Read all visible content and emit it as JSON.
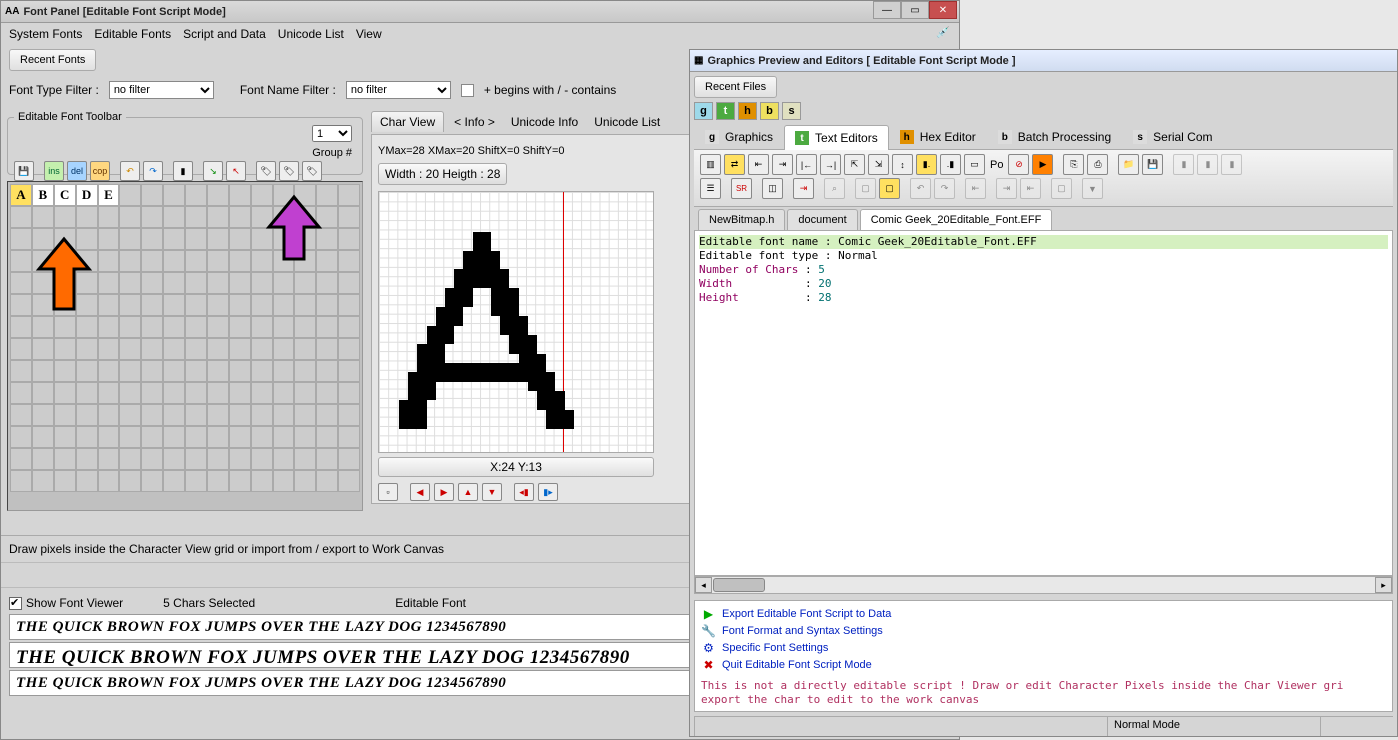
{
  "leftWindow": {
    "title": "Font Panel [Editable Font Script Mode]",
    "icon": "AA",
    "menu": [
      "System Fonts",
      "Editable Fonts",
      "Script and Data",
      "Unicode List",
      "View"
    ],
    "recentLabel": "Recent Fonts",
    "fontTypeFilterLabel": "Font Type Filter :",
    "fontTypeFilterValue": "no filter",
    "fontNameFilterLabel": "Font Name Filter :",
    "fontNameFilterValue": "no filter",
    "filterNote": "+ begins with / - contains",
    "toolbarLegend": "Editable Font Toolbar",
    "groupValue": "1",
    "groupLabel": "Group #",
    "btnIns": "ins",
    "btnDel": "del",
    "btnCop": "cop",
    "chars": [
      "A",
      "B",
      "C",
      "D",
      "E"
    ],
    "charViewTab": "Char View",
    "infoTab": "< Info >",
    "unicodeTab": "Unicode Info",
    "unicodeListTab": "Unicode List",
    "yxStats": "YMax=28  XMax=20  ShiftX=0  ShiftY=0",
    "whLabel": "Width : 20  Heigth : 28",
    "coord": "X:24 Y:13",
    "statusMsg": "Draw pixels inside the Character View grid or import from / export to Work Canvas",
    "showViewer": "Show Font Viewer",
    "charsSelected": "5 Chars Selected",
    "fontMode": "Editable Font",
    "preview": "THE QUICK BROWN FOX JUMPS OVER THE LAZY DOG 1234567890"
  },
  "rightWindow": {
    "title": "Graphics Preview and Editors [ Editable Font Script Mode ]",
    "recentFiles": "Recent Files",
    "tabs": {
      "g": "Graphics",
      "t": "Text Editors",
      "h": "Hex Editor",
      "b": "Batch Processing",
      "s": "Serial Com"
    },
    "fileTabs": [
      "NewBitmap.h",
      "document",
      "Comic Geek_20Editable_Font.EFF"
    ],
    "editor": {
      "l1": "Editable font name : Comic Geek_20Editable_Font.EFF",
      "l2": "Editable font type : Normal",
      "l3": "Number of Chars : 5",
      "l4": "Width           : 20",
      "l5": "Height          : 28"
    },
    "actions": {
      "export": "Export Editable Font Script to Data",
      "format": "Font Format and Syntax Settings",
      "specific": "Specific Font Settings",
      "quit": "Quit Editable Font Script Mode"
    },
    "help": "This is not a directly editable script ! Draw or edit Character Pixels inside the Char Viewer gri\nexport the char to edit to the work canvas",
    "status": "Normal Mode",
    "toolbarPoLabel": "Po"
  },
  "glyph_A": "00000000110000000000 00000000110000000000 00000001111000000000 00000001111000000000 00000011111100000000 00000011111100000000 00000111001110000000 00000111001110000000 00001110001110000000 00001110000111000000 00011100000111000000 00011100000011100000 00111000000011100000 00111000000001110000 00111111111111110000 01111111111111111000 01110000000000111000 01110000000000011100 11100000000000011100 11100000000000001110 11100000000000001110"
}
